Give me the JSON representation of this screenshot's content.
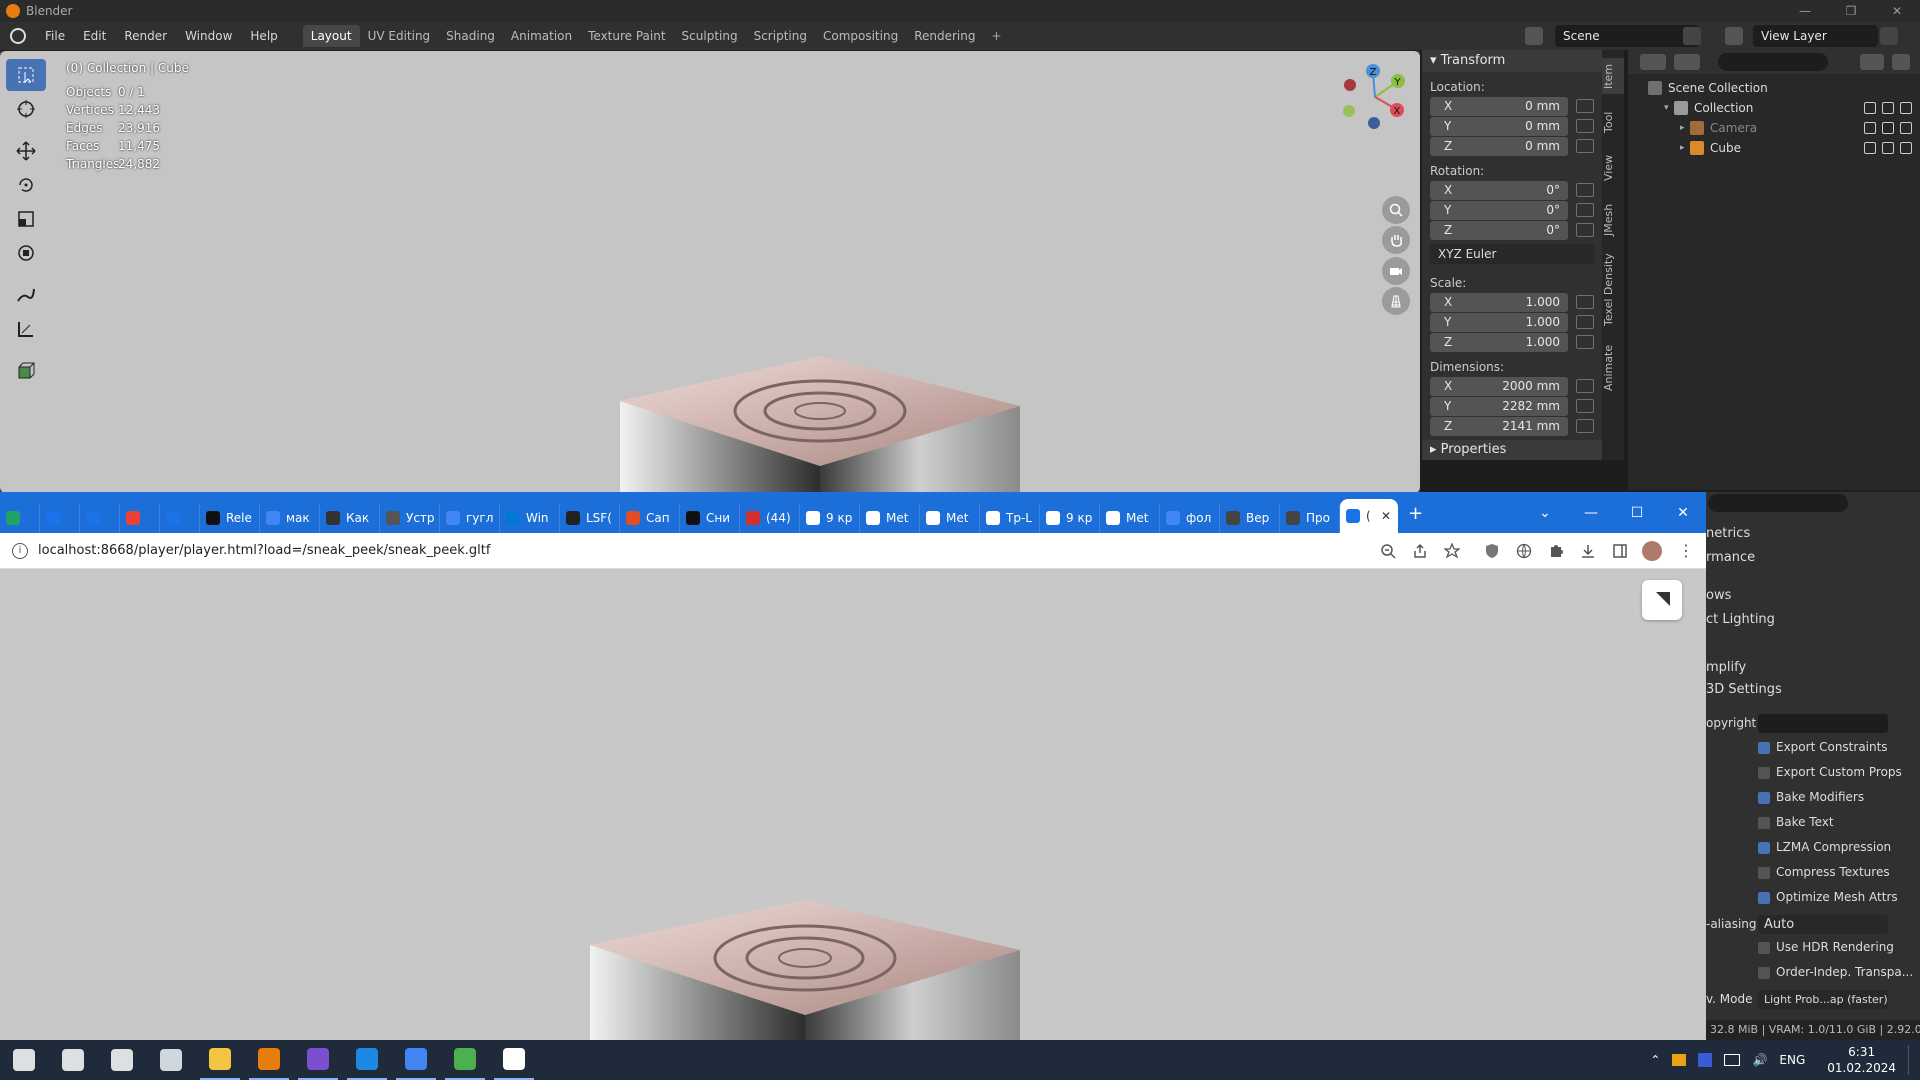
{
  "blender": {
    "window_title": "Blender",
    "menu": [
      "File",
      "Edit",
      "Render",
      "Window",
      "Help"
    ],
    "workspaces": [
      {
        "label": "Layout",
        "active": true
      },
      {
        "label": "UV Editing"
      },
      {
        "label": "Shading"
      },
      {
        "label": "Animation"
      },
      {
        "label": "Texture Paint"
      },
      {
        "label": "Sculpting"
      },
      {
        "label": "Scripting"
      },
      {
        "label": "Compositing"
      },
      {
        "label": "Rendering"
      }
    ],
    "workspace_add": "+",
    "scene": "Scene",
    "view_layer": "View Layer",
    "viewport": {
      "header": "(0) Collection | Cube",
      "stats": [
        {
          "k": "Objects",
          "v": "0 / 1"
        },
        {
          "k": "Vertices",
          "v": "12,443"
        },
        {
          "k": "Edges",
          "v": "23,916"
        },
        {
          "k": "Faces",
          "v": "11,475"
        },
        {
          "k": "Triangles",
          "v": "24,882"
        }
      ],
      "gizmo": {
        "x": "X",
        "y": "Y",
        "z": "Z"
      },
      "tools": [
        "select-box-icon",
        "cursor-icon",
        "move-icon",
        "rotate-icon",
        "scale-icon",
        "transform-icon",
        "annotate-icon",
        "measure-icon",
        "add-cube-icon"
      ]
    },
    "npanel": {
      "transform_header": "Transform",
      "location_label": "Location:",
      "location": [
        {
          "axis": "X",
          "value": "0 mm"
        },
        {
          "axis": "Y",
          "value": "0 mm"
        },
        {
          "axis": "Z",
          "value": "0 mm"
        }
      ],
      "rotation_label": "Rotation:",
      "rotation": [
        {
          "axis": "X",
          "value": "0°"
        },
        {
          "axis": "Y",
          "value": "0°"
        },
        {
          "axis": "Z",
          "value": "0°"
        }
      ],
      "rotation_mode": "XYZ Euler",
      "scale_label": "Scale:",
      "scale": [
        {
          "axis": "X",
          "value": "1.000"
        },
        {
          "axis": "Y",
          "value": "1.000"
        },
        {
          "axis": "Z",
          "value": "1.000"
        }
      ],
      "dimensions_label": "Dimensions:",
      "dimensions": [
        {
          "axis": "X",
          "value": "2000 mm"
        },
        {
          "axis": "Y",
          "value": "2282 mm"
        },
        {
          "axis": "Z",
          "value": "2141 mm"
        }
      ],
      "properties_header": "Properties",
      "tabs": [
        "Item",
        "Tool",
        "View",
        "JMesh",
        "Texel Density",
        "Animate"
      ]
    },
    "outliner": {
      "rows": [
        {
          "label": "Scene Collection",
          "indent": 0
        },
        {
          "label": "Collection",
          "indent": 1
        },
        {
          "label": "Camera",
          "indent": 2,
          "dim": true
        },
        {
          "label": "Cube",
          "indent": 2
        }
      ]
    },
    "properties": {
      "sections": [
        "netrics",
        "rmance",
        "ows",
        "ct Lighting",
        "mplify",
        "3D Settings"
      ],
      "copyright_label": "opyright",
      "checkboxes": [
        {
          "label": "Export Constraints",
          "on": true
        },
        {
          "label": "Export Custom Props",
          "on": false
        },
        {
          "label": "Bake Modifiers",
          "on": true
        },
        {
          "label": "Bake Text",
          "on": false
        },
        {
          "label": "LZMA Compression",
          "on": true
        },
        {
          "label": "Compress Textures",
          "on": false
        },
        {
          "label": "Optimize Mesh Attrs",
          "on": true
        }
      ],
      "aa_label": "-aliasing",
      "aa_value": "Auto",
      "checkboxes2": [
        {
          "label": "Use HDR Rendering",
          "on": false
        },
        {
          "label": "Order-Indep. Transpa...",
          "on": false
        }
      ],
      "env_label": "v. Mode",
      "env_value": "Light Prob...ap (faster)",
      "status": "32.8 MiB | VRAM: 1.0/11.0 GiB | 2.92.0"
    }
  },
  "chrome": {
    "tabs": [
      {
        "label": "",
        "color": "#21a366"
      },
      {
        "label": "",
        "color": "#1a73e8"
      },
      {
        "label": "",
        "color": "#1a73e8"
      },
      {
        "label": "",
        "color": "#ea4335"
      },
      {
        "label": "",
        "color": "#1a73e8"
      },
      {
        "label": "Rele",
        "color": "#111111"
      },
      {
        "label": "мак",
        "color": "#4285f4"
      },
      {
        "label": "Как",
        "color": "#333333"
      },
      {
        "label": "Устр",
        "color": "#555555"
      },
      {
        "label": "гугл",
        "color": "#4285f4"
      },
      {
        "label": "Win",
        "color": "#0078d4"
      },
      {
        "label": "LSF(",
        "color": "#222222"
      },
      {
        "label": "Сап",
        "color": "#e34c26"
      },
      {
        "label": "Сни",
        "color": "#111111"
      },
      {
        "label": "(44)",
        "color": "#d32f2f"
      },
      {
        "label": "9 кр",
        "color": "#ffffff"
      },
      {
        "label": "Met",
        "color": "#ffffff"
      },
      {
        "label": "Met",
        "color": "#ffffff"
      },
      {
        "label": "Тр-L",
        "color": "#ffffff"
      },
      {
        "label": "9 кр",
        "color": "#ffffff"
      },
      {
        "label": "Met",
        "color": "#ffffff"
      },
      {
        "label": "фол",
        "color": "#4285f4"
      },
      {
        "label": "Вер",
        "color": "#444444"
      },
      {
        "label": "Про",
        "color": "#444444"
      },
      {
        "label": "(",
        "color": "#1a73e8",
        "active": true
      }
    ],
    "new_tab": "+",
    "url": "localhost:8668/player/player.html?load=/sneak_peek/sneak_peek.gltf"
  },
  "taskbar": {
    "apps": [
      {
        "name": "windows-start-icon",
        "color": "#ffffff"
      },
      {
        "name": "search-icon",
        "color": "#ffffff"
      },
      {
        "name": "task-view-icon",
        "color": "#ffffff"
      },
      {
        "name": "settings-icon",
        "color": "#cfd8dc"
      },
      {
        "name": "file-explorer-icon",
        "color": "#f4c542"
      },
      {
        "name": "blender-icon",
        "color": "#e87d0d"
      },
      {
        "name": "save-disk-icon",
        "color": "#7b4fd0"
      },
      {
        "name": "app-blue-icon",
        "color": "#1e88e5"
      },
      {
        "name": "browser-icon",
        "color": "#4285f4"
      },
      {
        "name": "xbox-icon",
        "color": "#4caf50"
      },
      {
        "name": "terminal-icon",
        "color": "#ffffff"
      }
    ],
    "lang": "ENG",
    "time": "6:31",
    "date": "01.02.2024"
  }
}
